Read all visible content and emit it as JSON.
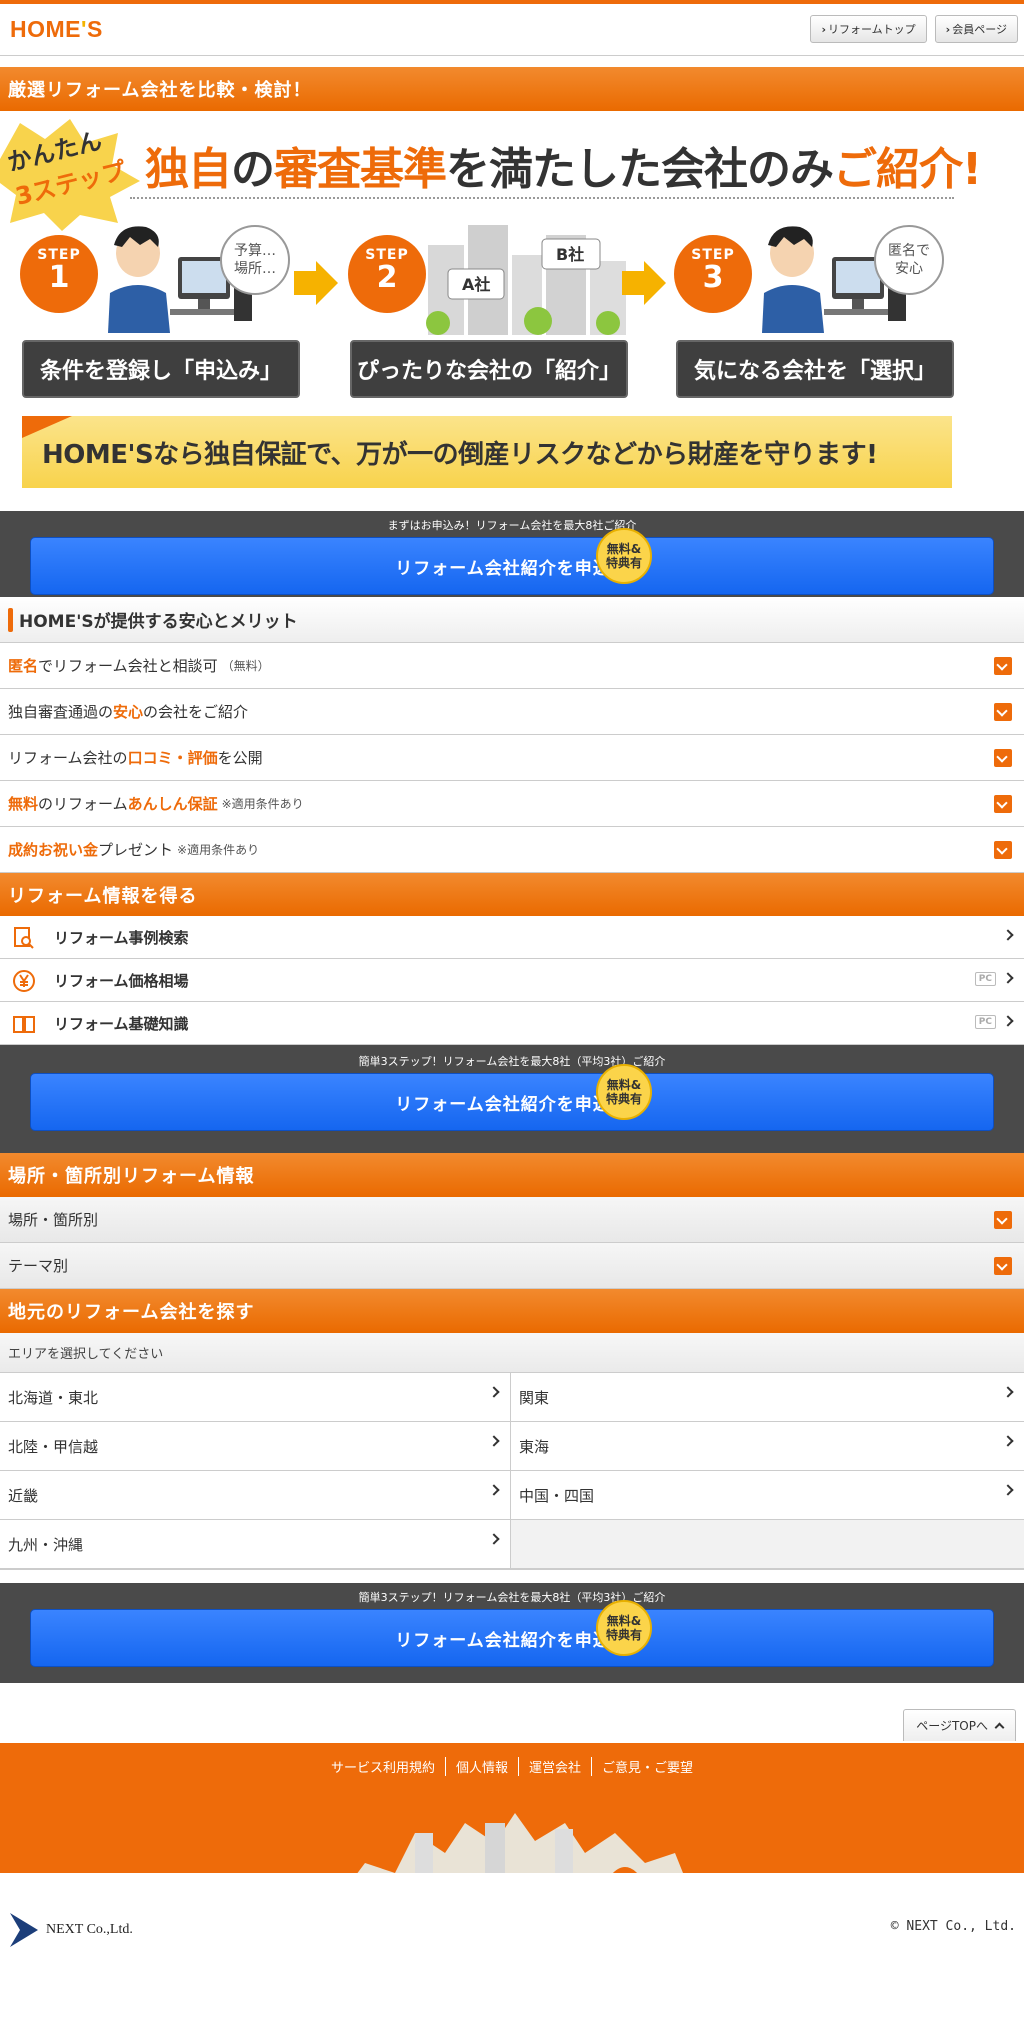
{
  "header": {
    "logo": "HOME'S",
    "buttons": [
      "リフォームトップ",
      "会員ページ"
    ]
  },
  "intro": {
    "heading": "厳選リフォーム会社を比較・検討！",
    "badge_line1": "かんたん",
    "badge_line2": "3ステップ",
    "title_parts": [
      "独自",
      "の",
      "審査基準",
      "を満たした会社のみ",
      "ご紹介!"
    ],
    "steps": [
      {
        "step": "STEP",
        "num": "1",
        "bubble": "予算…\n場所…",
        "label": "条件を登録し「申込み」"
      },
      {
        "step": "STEP",
        "num": "2",
        "bubble": "",
        "label": "ぴったりな会社の「紹介」",
        "company_a": "A社",
        "company_b": "B社"
      },
      {
        "step": "STEP",
        "num": "3",
        "bubble": "匿名で\n安心",
        "label": "気になる会社を「選択」"
      }
    ],
    "guarantee": "HOME'Sなら独自保証で、万が一の倒産リスクなどから財産を守ります!"
  },
  "cta": [
    {
      "caption": "まずはお申込み！リフォーム会社を最大8社ご紹介",
      "button": "リフォーム会社紹介を申込む",
      "badge": "無料&\n特典有"
    },
    {
      "caption": "簡単3ステップ！リフォーム会社を最大8社（平均3社）ご紹介",
      "button": "リフォーム会社紹介を申込む",
      "badge": "無料&\n特典有"
    },
    {
      "caption": "簡単3ステップ！リフォーム会社を最大8社（平均3社）ご紹介",
      "button": "リフォーム会社紹介を申込む",
      "badge": "無料&\n特典有"
    }
  ],
  "merits": {
    "heading": "HOME'Sが提供する安心とメリット",
    "items": [
      {
        "o1": "匿名",
        "t1": "でリフォーム会社と相談可",
        "small": "（無料）"
      },
      {
        "t0": "独自審査通過の",
        "o1": "安心",
        "t1": "の会社をご紹介",
        "small": ""
      },
      {
        "t0": "リフォーム会社の",
        "o1": "口コミ・評価",
        "t1": "を公開",
        "small": ""
      },
      {
        "o1": "無料",
        "t1": "のリフォーム",
        "o2": "あんしん保証",
        "small": "※適用条件あり"
      },
      {
        "o1": "成約お祝い金",
        "t1": "プレゼント",
        "small": "※適用条件あり"
      }
    ]
  },
  "info": {
    "heading": "リフォーム情報を得る",
    "items": [
      {
        "label": "リフォーム事例検索",
        "icon": "case-search-icon",
        "pc": ""
      },
      {
        "label": "リフォーム価格相場",
        "icon": "yen-icon",
        "pc": "PC"
      },
      {
        "label": "リフォーム基礎知識",
        "icon": "book-icon",
        "pc": "PC"
      }
    ]
  },
  "place": {
    "heading": "場所・箇所別リフォーム情報",
    "items": [
      "場所・箇所別",
      "テーマ別"
    ]
  },
  "area": {
    "heading": "地元のリフォーム会社を探す",
    "prompt": "エリアを選択してください",
    "regions": [
      "北海道・東北",
      "関東",
      "北陸・甲信越",
      "東海",
      "近畿",
      "中国・四国",
      "九州・沖縄"
    ]
  },
  "footer": {
    "pagetop": "ページTOPへ",
    "links": [
      "サービス利用規約",
      "個人情報",
      "運営会社",
      "ご意見・ご要望"
    ],
    "company": "NEXT Co.,Ltd.",
    "copyright": "© NEXT Co., Ltd."
  },
  "colors": {
    "accent": "#ee6b0a",
    "cta_blue": "#1f6ff5",
    "dark": "#4a4a4a",
    "yellow": "#f8d34c"
  }
}
